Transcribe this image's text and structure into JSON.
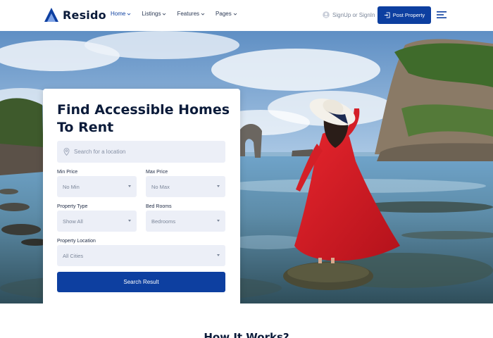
{
  "brand": {
    "name": "Resido",
    "accent": "#0d3fa0"
  },
  "nav": {
    "items": [
      {
        "label": "Home",
        "active": true
      },
      {
        "label": "Listings",
        "active": false
      },
      {
        "label": "Features",
        "active": false
      },
      {
        "label": "Pages",
        "active": false
      }
    ],
    "signin_label": "SignUp or SignIn",
    "post_property_label": "Post Property"
  },
  "hero": {
    "title": "Find Accessible Homes To Rent",
    "location_placeholder": "Search for a location",
    "fields": {
      "min_price": {
        "label": "Min Price",
        "value": "No Min"
      },
      "max_price": {
        "label": "Max Price",
        "value": "No Max"
      },
      "property_type": {
        "label": "Property Type",
        "value": "Show All"
      },
      "bed_rooms": {
        "label": "Bed Rooms",
        "value": "Bedrooms"
      },
      "property_location": {
        "label": "Property Location",
        "value": "All Cities"
      }
    },
    "search_button": "Search Result"
  },
  "section": {
    "title": "How It Works?"
  }
}
